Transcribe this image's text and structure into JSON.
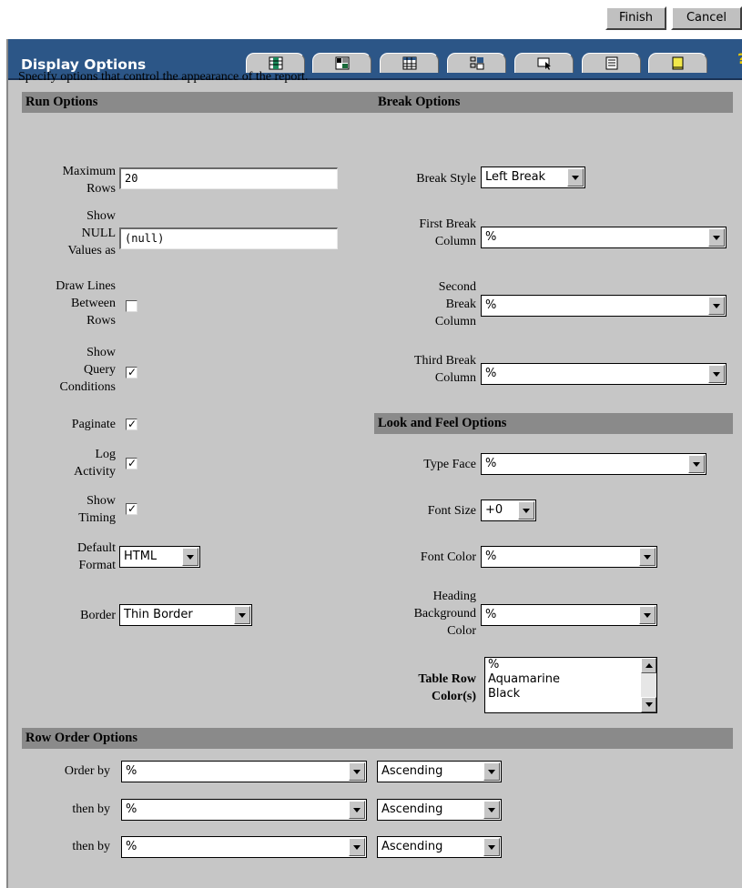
{
  "top_buttons": {
    "finish": "Finish",
    "cancel": "Cancel"
  },
  "window": {
    "title": "Display Options"
  },
  "tabs": [
    {
      "icon": "columns-icon"
    },
    {
      "icon": "chart-xy-icon"
    },
    {
      "icon": "table-grid-icon"
    },
    {
      "icon": "display-options-icon"
    },
    {
      "icon": "cursor-select-icon"
    },
    {
      "icon": "document-icon"
    },
    {
      "icon": "note-icon"
    }
  ],
  "intro": "Specify options that control the appearance of the report.",
  "run_options": {
    "heading": "Run Options",
    "maximum_rows": {
      "label": "Maximum Rows",
      "value": "20"
    },
    "null_values": {
      "label": "Show NULL Values as",
      "value": "(null)"
    },
    "draw_lines": {
      "label": "Draw Lines Between Rows",
      "checked": false
    },
    "show_query_conditions": {
      "label": "Show Query Conditions",
      "checked": true
    },
    "paginate": {
      "label": "Paginate",
      "checked": true
    },
    "log_activity": {
      "label": "Log Activity",
      "checked": true
    },
    "show_timing": {
      "label": "Show Timing",
      "checked": true
    },
    "default_format": {
      "label": "Default Format",
      "value": "HTML"
    },
    "border": {
      "label": "Border",
      "value": "Thin Border"
    }
  },
  "break_options": {
    "heading": "Break Options",
    "break_style": {
      "label": "Break Style",
      "value": "Left Break"
    },
    "first_break": {
      "label": "First Break Column",
      "value": "%"
    },
    "second_break": {
      "label": "Second Break Column",
      "value": "%"
    },
    "third_break": {
      "label": "Third Break Column",
      "value": "%"
    }
  },
  "look_feel": {
    "heading": "Look and Feel Options",
    "type_face": {
      "label": "Type Face",
      "value": "%"
    },
    "font_size": {
      "label": "Font Size",
      "value": "+0"
    },
    "font_color": {
      "label": "Font Color",
      "value": "%"
    },
    "heading_bg": {
      "label": "Heading Background Color",
      "value": "%"
    },
    "table_row_colors": {
      "label": "Table Row Color(s)",
      "options": [
        "%",
        "Aquamarine",
        "Black"
      ]
    }
  },
  "row_order": {
    "heading": "Row Order Options",
    "rows": [
      {
        "label": "Order by",
        "column": "%",
        "direction": "Ascending"
      },
      {
        "label": "then by",
        "column": "%",
        "direction": "Ascending"
      },
      {
        "label": "then by",
        "column": "%",
        "direction": "Ascending"
      }
    ]
  },
  "colors": {
    "title_bar": "#2c5687",
    "panel": "#c6c6c6",
    "section_header": "#8a8a8a"
  }
}
